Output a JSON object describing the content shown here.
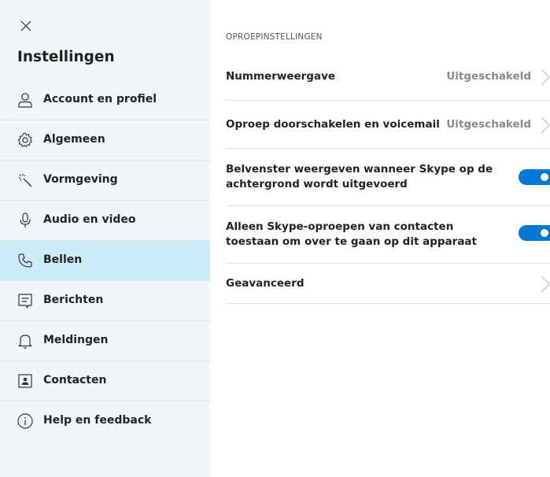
{
  "sidebar": {
    "title": "Instellingen",
    "items": [
      {
        "label": "Account en profiel",
        "icon": "person-icon"
      },
      {
        "label": "Algemeen",
        "icon": "gear-icon"
      },
      {
        "label": "Vormgeving",
        "icon": "magic-wand-icon"
      },
      {
        "label": "Audio en video",
        "icon": "microphone-icon"
      },
      {
        "label": "Bellen",
        "icon": "phone-icon",
        "active": true
      },
      {
        "label": "Berichten",
        "icon": "message-icon"
      },
      {
        "label": "Meldingen",
        "icon": "bell-icon"
      },
      {
        "label": "Contacten",
        "icon": "contact-card-icon"
      },
      {
        "label": "Help en feedback",
        "icon": "info-icon"
      }
    ]
  },
  "content": {
    "section_title": "OPROEPINSTELLINGEN",
    "settings": [
      {
        "label": "Nummerweergave",
        "value": "Uitgeschakeld"
      },
      {
        "label": "Oproep doorschakelen en voicemail",
        "value": "Uitgeschakeld"
      },
      {
        "label": "Belvenster weergeven wanneer Skype op de achtergrond wordt uitgevoerd",
        "toggle": true
      },
      {
        "label": "Alleen Skype-oproepen van contacten toestaan om over te gaan op dit apparaat",
        "toggle": true
      },
      {
        "label": "Geavanceerd"
      }
    ]
  },
  "colors": {
    "sidebar_bg": "#f3f6f8",
    "active_item_bg": "#ccecf8",
    "toggle_on": "#0078d4",
    "muted_value": "#8a8a8a"
  }
}
